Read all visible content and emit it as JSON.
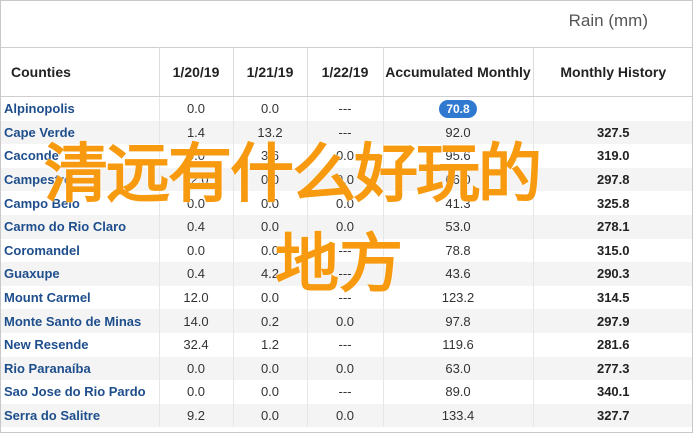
{
  "unit_label": "Rain (mm)",
  "overlay": {
    "line1": "清远有什么好玩的",
    "line2": "地方"
  },
  "headers": [
    "Counties",
    "1/20/19",
    "1/21/19",
    "1/22/19",
    "Accumulated Monthly",
    "Monthly History"
  ],
  "rows": [
    {
      "name": "Alpinopolis",
      "d1": "0.0",
      "d2": "0.0",
      "d3": "---",
      "acc": "70.8",
      "hist": ""
    },
    {
      "name": "Cape Verde",
      "d1": "1.4",
      "d2": "13.2",
      "d3": "---",
      "acc": "92.0",
      "hist": "327.5"
    },
    {
      "name": "Caconde",
      "d1": "0.0",
      "d2": "3.6",
      "d3": "0.0",
      "acc": "95.6",
      "hist": "319.0"
    },
    {
      "name": "Campestre",
      "d1": "32.0",
      "d2": "0.0",
      "d3": "0.0",
      "acc": "66.0",
      "hist": "297.8"
    },
    {
      "name": "Campo Belo",
      "d1": "0.0",
      "d2": "0.0",
      "d3": "0.0",
      "acc": "41.3",
      "hist": "325.8"
    },
    {
      "name": "Carmo do Rio Claro",
      "d1": "0.4",
      "d2": "0.0",
      "d3": "0.0",
      "acc": "53.0",
      "hist": "278.1"
    },
    {
      "name": "Coromandel",
      "d1": "0.0",
      "d2": "0.0",
      "d3": "---",
      "acc": "78.8",
      "hist": "315.0"
    },
    {
      "name": "Guaxupe",
      "d1": "0.4",
      "d2": "4.2",
      "d3": "---",
      "acc": "43.6",
      "hist": "290.3"
    },
    {
      "name": "Mount Carmel",
      "d1": "12.0",
      "d2": "0.0",
      "d3": "---",
      "acc": "123.2",
      "hist": "314.5"
    },
    {
      "name": "Monte Santo de Minas",
      "d1": "14.0",
      "d2": "0.2",
      "d3": "0.0",
      "acc": "97.8",
      "hist": "297.9"
    },
    {
      "name": "New Resende",
      "d1": "32.4",
      "d2": "1.2",
      "d3": "---",
      "acc": "119.6",
      "hist": "281.6"
    },
    {
      "name": "Rio Paranaíba",
      "d1": "0.0",
      "d2": "0.0",
      "d3": "0.0",
      "acc": "63.0",
      "hist": "277.3"
    },
    {
      "name": "Sao Jose do Rio Pardo",
      "d1": "0.0",
      "d2": "0.0",
      "d3": "---",
      "acc": "89.0",
      "hist": "340.1"
    },
    {
      "name": "Serra do Salitre",
      "d1": "9.2",
      "d2": "0.0",
      "d3": "0.0",
      "acc": "133.4",
      "hist": "327.7"
    }
  ]
}
